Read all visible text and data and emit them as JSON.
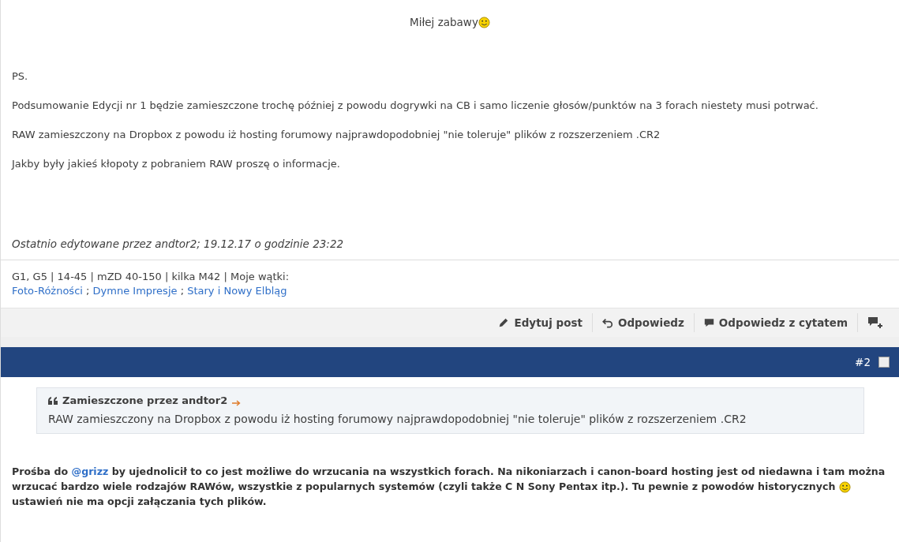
{
  "post1": {
    "greeting": "Miłej zabawy",
    "ps": "PS.",
    "paragraphs": [
      "Podsumowanie Edycji nr 1 będzie zamieszczone trochę później z powodu dogrywki na CB i samo liczenie głosów/punktów na 3 forach niestety musi potrwać.",
      "RAW zamieszczony na Dropbox z powodu iż hosting forumowy najprawdopodobniej \"nie toleruje\" plików z rozszerzeniem .CR2",
      "Jakby były jakieś kłopoty z pobraniem RAW proszę o informacje."
    ],
    "edited": "Ostatnio edytowane przez andtor2; 19.12.17 o godzinie 23:22",
    "signature": {
      "text": "G1, G5 | 14-45 | mZD 40-150 | kilka M42 | Moje wątki:",
      "links": [
        {
          "label": "Foto-Różności"
        },
        {
          "label": "Dymne Impresje"
        },
        {
          "label": "Stary i Nowy Elbląg"
        }
      ],
      "separator": ";"
    },
    "actions": [
      {
        "kind": "edit",
        "label": "Edytuj post"
      },
      {
        "kind": "reply",
        "label": "Odpowiedz"
      },
      {
        "kind": "quote",
        "label": "Odpowiedz z cytatem"
      },
      {
        "kind": "multiquote"
      }
    ]
  },
  "post2": {
    "number": "#2",
    "checked": false,
    "quote": {
      "author": "Zamieszczone przez andtor2",
      "text": "RAW zamieszczony na Dropbox z powodu iż hosting forumowy najprawdopodobniej \"nie toleruje\" plików z rozszerzeniem .CR2"
    },
    "body": [
      {
        "kind": "text",
        "text": "Prośba do "
      },
      {
        "kind": "link",
        "text": "@grizz"
      },
      {
        "kind": "text",
        "text": " by ujednolicił to co jest możliwe do wrzucania na wszystkich forach. Na nikoniarzach i canon-board hosting jest od niedawna i tam można wrzucać bardzo wiele rodzajów RAWów, wszystkie z popularnych systemów (czyli także C N Sony Pentax itp.). Tu pewnie z powodów historycznych "
      },
      {
        "kind": "emoji"
      },
      {
        "kind": "text",
        "text": " ustawień nie ma opcji załączania tych plików."
      }
    ]
  }
}
